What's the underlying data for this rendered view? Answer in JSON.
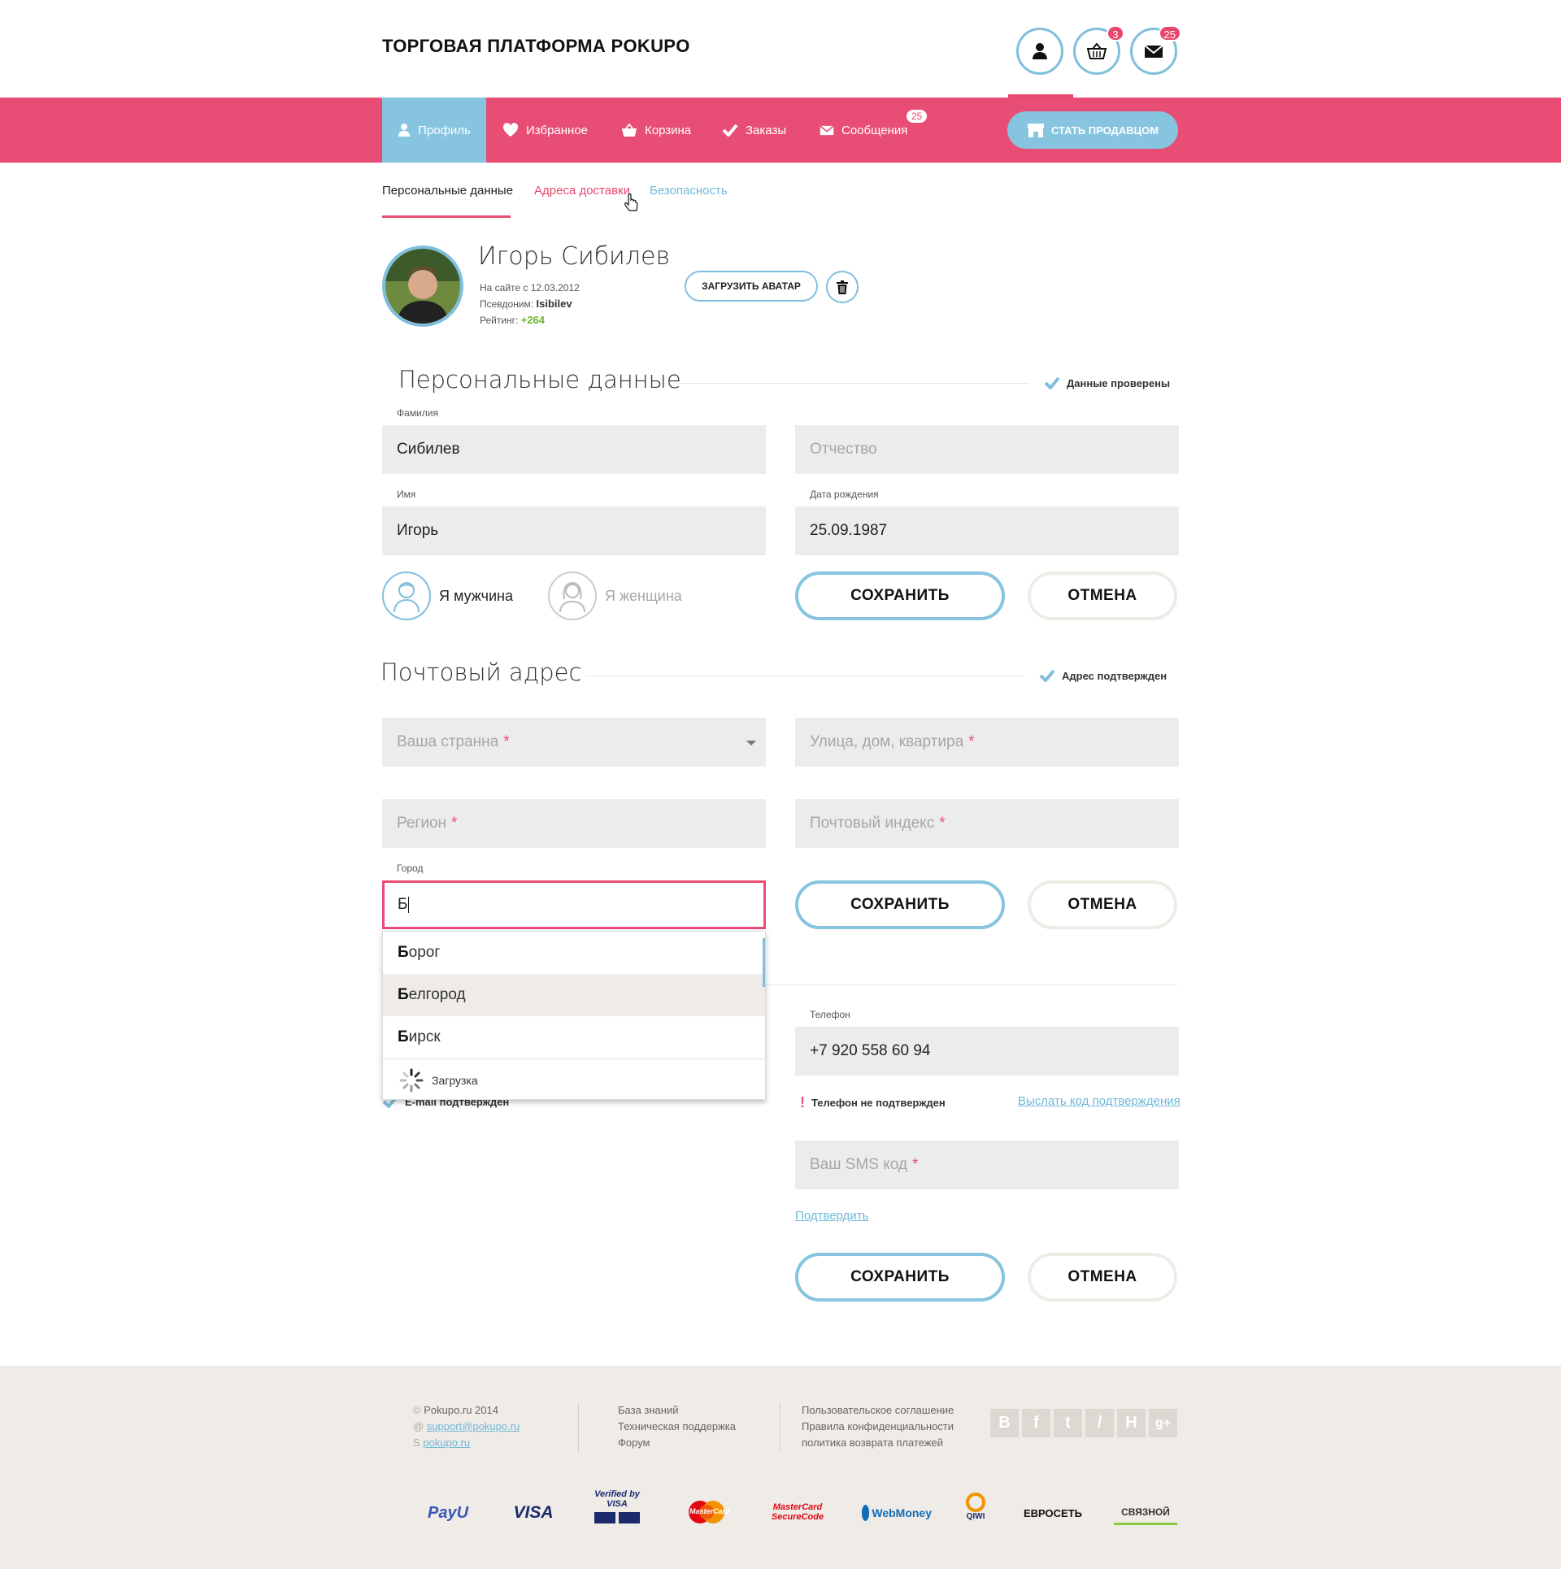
{
  "header": {
    "brand": "ТОРГОВАЯ ПЛАТФОРМА POKUPO",
    "cart_count": "3",
    "messages_count": "25"
  },
  "nav": {
    "items": [
      {
        "label": "Профиль",
        "icon": "user-icon"
      },
      {
        "label": "Избранное",
        "icon": "heart-icon"
      },
      {
        "label": "Корзина",
        "icon": "basket-icon"
      },
      {
        "label": "Заказы",
        "icon": "check-icon"
      },
      {
        "label": "Сообщения",
        "icon": "envelope-icon"
      }
    ],
    "messages_badge": "25",
    "seller_button": "СТАТЬ ПРОДАВЦОМ",
    "colors": {
      "bar": "#e84d76",
      "active": "#86c4df"
    }
  },
  "tabs": [
    "Персональные данные",
    "Адреса доставки",
    "Безопасность"
  ],
  "profile": {
    "name": "Игорь Сибилев",
    "since_label": "На сайте с 12.03.2012",
    "nick_label": "Псевдоним:",
    "nick": "Isibilev",
    "rating_label": "Рейтинг:",
    "rating": "+264",
    "upload_button": "ЗАГРУЗИТЬ АВАТАР"
  },
  "personal": {
    "title": "Персональные данные",
    "status": "Данные проверены",
    "lastname_label": "Фамилия",
    "lastname": "Сибилев",
    "patronymic_placeholder": "Отчество",
    "firstname_label": "Имя",
    "firstname": "Игорь",
    "birth_label": "Дата рождения",
    "birth": "25.09.1987",
    "male": "Я мужчина",
    "female": "Я женщина",
    "save": "СОХРАНИТЬ",
    "cancel": "ОТМЕНА"
  },
  "postal": {
    "title": "Почтовый адрес",
    "status": "Адрес подтвержден",
    "country_placeholder": "Ваша странна",
    "street_placeholder": "Улица, дом, квартира",
    "region_placeholder": "Регион",
    "zip_placeholder": "Почтовый индекс",
    "city_label": "Город",
    "city_value": "Б",
    "suggestions": [
      {
        "bold": "Б",
        "rest": "орог"
      },
      {
        "bold": "Б",
        "rest": "елгород"
      },
      {
        "bold": "Б",
        "rest": "ирск"
      }
    ],
    "loading": "Загрузка",
    "save": "СОХРАНИТЬ",
    "cancel": "ОТМЕНА"
  },
  "contacts": {
    "email_status": "E-mail подтвержден",
    "phone_label": "Телефон",
    "phone": "+7 920 558 60 94",
    "phone_status": "Телефон не подтвержден",
    "send_code": "Выслать код подтверждения",
    "sms_placeholder": "Ваш SMS код",
    "confirm": "Подтвердить",
    "save": "СОХРАНИТЬ",
    "cancel": "ОТМЕНА"
  },
  "footer": {
    "copyright": "Pokupo.ru 2014",
    "email": "support@pokupo.ru",
    "skype": "pokupo.ru",
    "links1": [
      "База знаний",
      "Техническая поддержка",
      "Форум"
    ],
    "links2": [
      "Пользовательское соглашение",
      "Правила конфиденциальности",
      "политика возврата платежей"
    ],
    "social": [
      "vk-icon",
      "facebook-icon",
      "twitter-icon",
      "livejournal-icon",
      "habr-icon",
      "googleplus-icon"
    ],
    "payments": [
      "PayU",
      "VISA",
      "Verified by VISA",
      "MasterCard",
      "MasterCard SecureCode",
      "WebMoney",
      "QIWI",
      "ЕВРОСЕТЬ",
      "СВЯЗНОЙ"
    ]
  }
}
